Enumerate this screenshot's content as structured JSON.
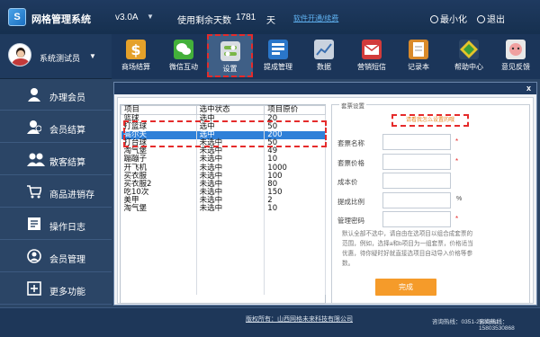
{
  "header": {
    "logo_letter": "S",
    "app_title": "网格管理系统",
    "version": "v3.0A",
    "days_label": "使用剩余天数",
    "days_value": "1781",
    "days_unit": "天",
    "renew_link": "软件开通/续费",
    "minimize_label": "最小化",
    "exit_label": "退出"
  },
  "user": {
    "name": "系统测试员"
  },
  "toolbar": [
    {
      "label": "商场结算",
      "icon": "dollar-icon"
    },
    {
      "label": "微信互动",
      "icon": "wechat-icon"
    },
    {
      "label": "设置",
      "icon": "settings-icon"
    },
    {
      "label": "提成管理",
      "icon": "commission-icon"
    },
    {
      "label": "数据",
      "icon": "chart-icon"
    },
    {
      "label": "营销短信",
      "icon": "mail-icon"
    },
    {
      "label": "记录本",
      "icon": "notebook-icon"
    },
    {
      "label": "帮助中心",
      "icon": "help-icon"
    },
    {
      "label": "意见反馈",
      "icon": "feedback-icon"
    }
  ],
  "sidebar": [
    {
      "label": "办理会员",
      "icon": "user-icon"
    },
    {
      "label": "会员结算",
      "icon": "member-checkout-icon"
    },
    {
      "label": "散客结算",
      "icon": "guests-icon"
    },
    {
      "label": "商品进销存",
      "icon": "cart-icon"
    },
    {
      "label": "操作日志",
      "icon": "log-icon"
    },
    {
      "label": "会员管理",
      "icon": "member-manage-icon"
    },
    {
      "label": "更多功能",
      "icon": "plus-icon"
    }
  ],
  "dialog": {
    "close_label": "x",
    "table": {
      "headers": [
        "项目",
        "选中状态",
        "项目原价"
      ],
      "rows": [
        {
          "name": "篮球",
          "status": "选中",
          "price": "20",
          "selected": false
        },
        {
          "name": "打篮球",
          "status": "选中",
          "price": "50",
          "selected": false
        },
        {
          "name": "高尔夫",
          "status": "选中",
          "price": "200",
          "selected": true
        },
        {
          "name": "打台球",
          "status": "未选中",
          "price": "50",
          "selected": false
        },
        {
          "name": "淘气堡",
          "status": "未选中",
          "price": "49",
          "selected": false
        },
        {
          "name": "蹦蹦子",
          "status": "未选中",
          "price": "10",
          "selected": false
        },
        {
          "name": "开飞机",
          "status": "未选中",
          "price": "1000",
          "selected": false
        },
        {
          "name": "买衣服",
          "status": "未选中",
          "price": "100",
          "selected": false
        },
        {
          "name": "买衣服2",
          "status": "未选中",
          "price": "80",
          "selected": false
        },
        {
          "name": "吃10次",
          "status": "未选中",
          "price": "150",
          "selected": false
        },
        {
          "name": "美甲",
          "status": "未选中",
          "price": "2",
          "selected": false
        },
        {
          "name": "淘气堡",
          "status": "未选中",
          "price": "10",
          "selected": false
        }
      ]
    },
    "form": {
      "legend": "套票设置",
      "tip": "请看我怎么设置的哦",
      "fields": [
        {
          "label": "套票名称",
          "value": "",
          "required": true,
          "suffix": ""
        },
        {
          "label": "套票价格",
          "value": "",
          "required": true,
          "suffix": ""
        },
        {
          "label": "成本价",
          "value": "",
          "required": false,
          "suffix": ""
        },
        {
          "label": "提成比例",
          "value": "",
          "required": false,
          "suffix": "%"
        },
        {
          "label": "管理密码",
          "value": "",
          "required": true,
          "suffix": ""
        }
      ],
      "help_text": "默认全部不选中，请自由在选项目以组合成套票的范围，例如，选择a和b项目为一组套票，价格适当优惠，待你疑时好就直接选项目自动导入价格等参数。",
      "done_label": "完成"
    }
  },
  "footer": {
    "copyright": "版权所有：山西网格未来科技有限公司",
    "hotline1": "咨询热线：0351-2520861",
    "hotline2": "咨询热线：15803530868"
  },
  "colors": {
    "accent_red": "#e52b2b",
    "selected_row": "#2f80d8",
    "done_button": "#f59b2a",
    "background": "#2d4566"
  }
}
